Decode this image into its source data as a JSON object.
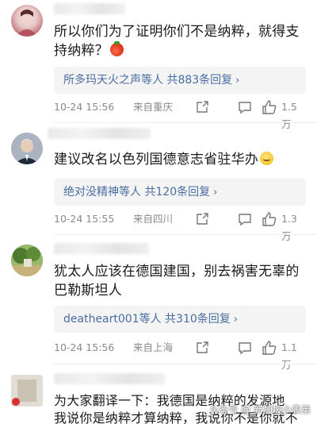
{
  "comments": [
    {
      "text": "所以你们为了证明你们不是纳粹，就得支持纳粹？",
      "emoji": "🍅",
      "reply_summary": "所多玛天火之声等人 共883条回复",
      "time": "10-24 15:56",
      "location": "来自重庆",
      "likes": "1.5万"
    },
    {
      "text": "建议改名以色列国德意志省驻华办",
      "emoji": "🤤",
      "reply_summary": "绝对没精神等人 共120条回复",
      "time": "10-24 15:55",
      "location": "来自四川",
      "likes": "1.3万"
    },
    {
      "text": "犹太人应该在德国建国，别去祸害无辜的巴勒斯坦人",
      "reply_summary": "deatheart001等人 共310条回复",
      "time": "10-24 15:56",
      "location": "来自上海",
      "likes": "1.1万"
    },
    {
      "text_line1": "为大家翻译一下：我德国是纳粹的发源地",
      "text_line2": "我说你是纳粹才算纳粹，我说你不是你就不"
    }
  ],
  "icons": {
    "share": "share-icon",
    "reply": "comment-icon",
    "like": "thumbs-up-icon",
    "reply_chevron": "chevron-right-icon"
  },
  "watermark": "头条号 @ 新加坡小表弟",
  "colors": {
    "link": "#4a6da1",
    "meta": "#8a8a8a",
    "reply_bg": "#f4f4f4"
  }
}
